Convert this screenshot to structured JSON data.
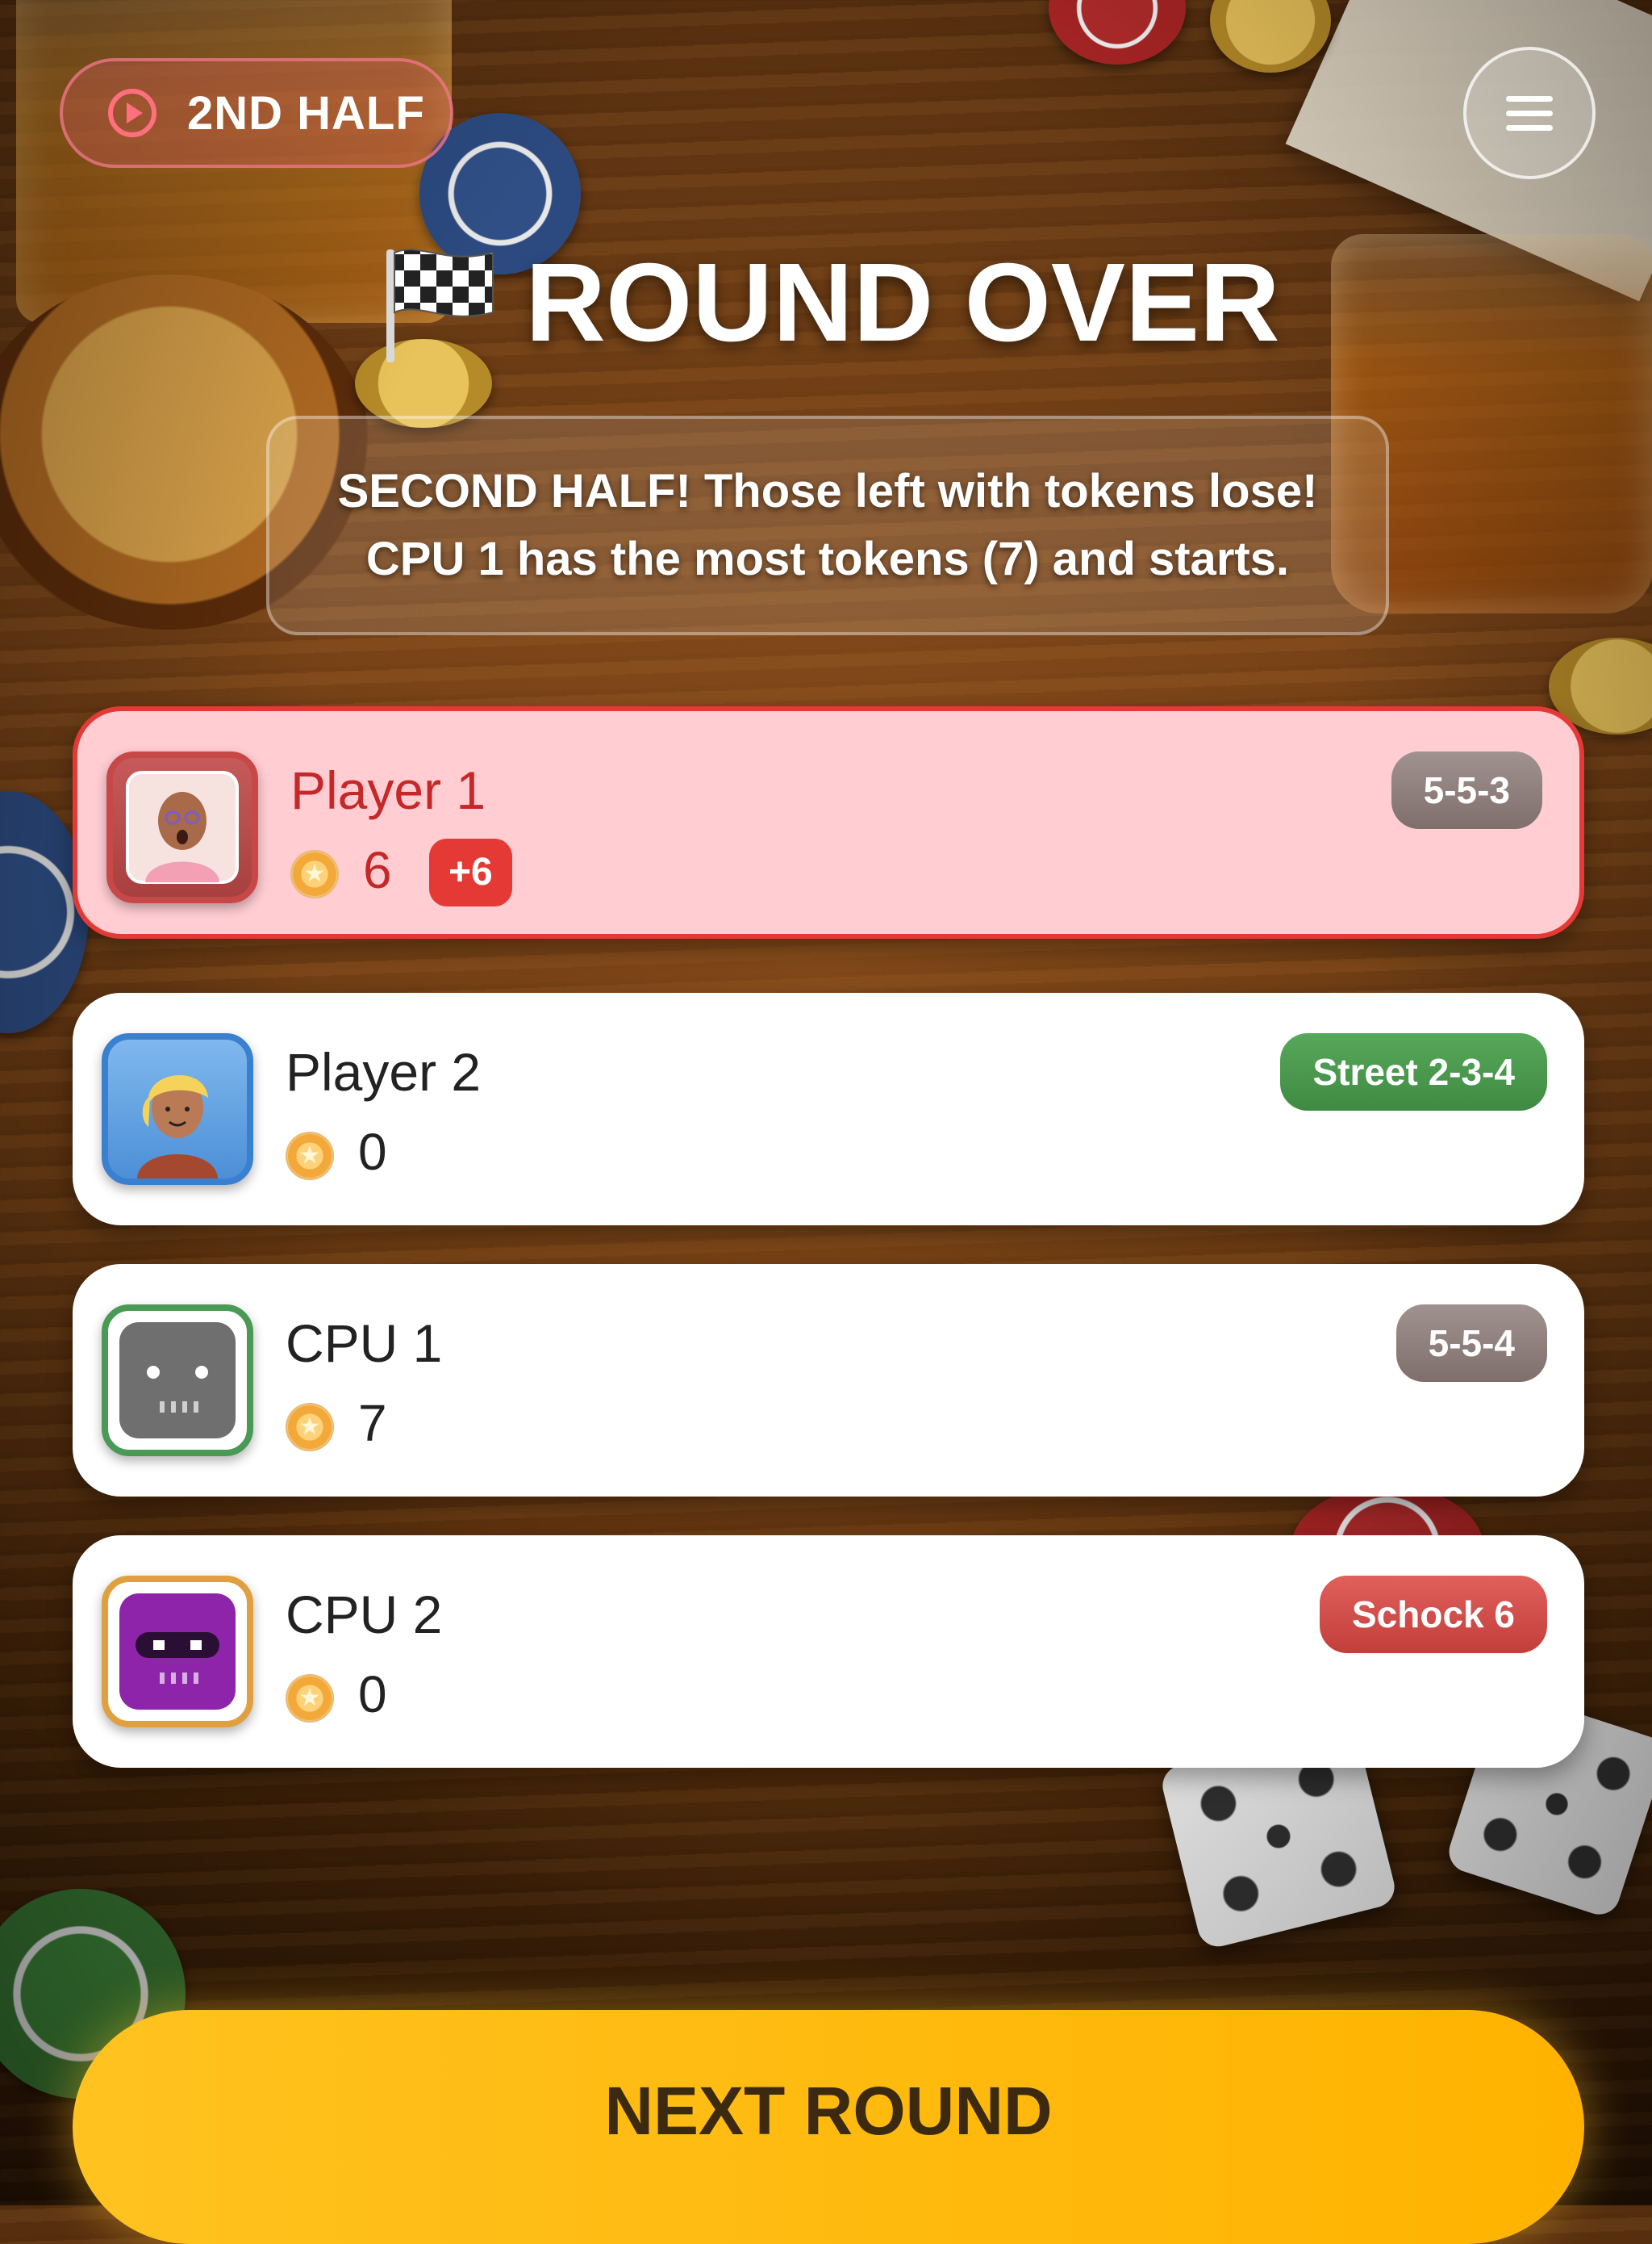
{
  "header": {
    "half_label": "2ND HALF",
    "half_icon": "play-circle-icon",
    "menu_icon": "hamburger-menu-icon"
  },
  "title": {
    "icon": "checkered-flag-icon",
    "text": "ROUND OVER"
  },
  "message": {
    "line1": "SECOND HALF! Those left with tokens lose!",
    "line2": "CPU 1 has the most tokens (7) and starts."
  },
  "players": [
    {
      "name": "Player 1",
      "tokens": "6",
      "delta": "+6",
      "hand": "5-5-3",
      "hand_color": "#8c7d7a",
      "avatar_border": "#c84848",
      "status": "loser"
    },
    {
      "name": "Player 2",
      "tokens": "0",
      "hand": "Street 2-3-4",
      "hand_color": "#4a9a4e",
      "avatar_border": "#3a80d0"
    },
    {
      "name": "CPU 1",
      "tokens": "7",
      "hand": "5-5-4",
      "hand_color": "#8c7d7a",
      "avatar_border": "#4a9a55"
    },
    {
      "name": "CPU 2",
      "tokens": "0",
      "hand": "Schock 6",
      "hand_color": "#d0504c",
      "avatar_border": "#e0a040"
    }
  ],
  "coin_icon": "gold-coin-icon",
  "next_button": {
    "label": "NEXT ROUND"
  },
  "colors": {
    "accent_yellow": "#ffb300",
    "loser_red": "#e53935",
    "loser_bg": "#ffcdd2"
  }
}
